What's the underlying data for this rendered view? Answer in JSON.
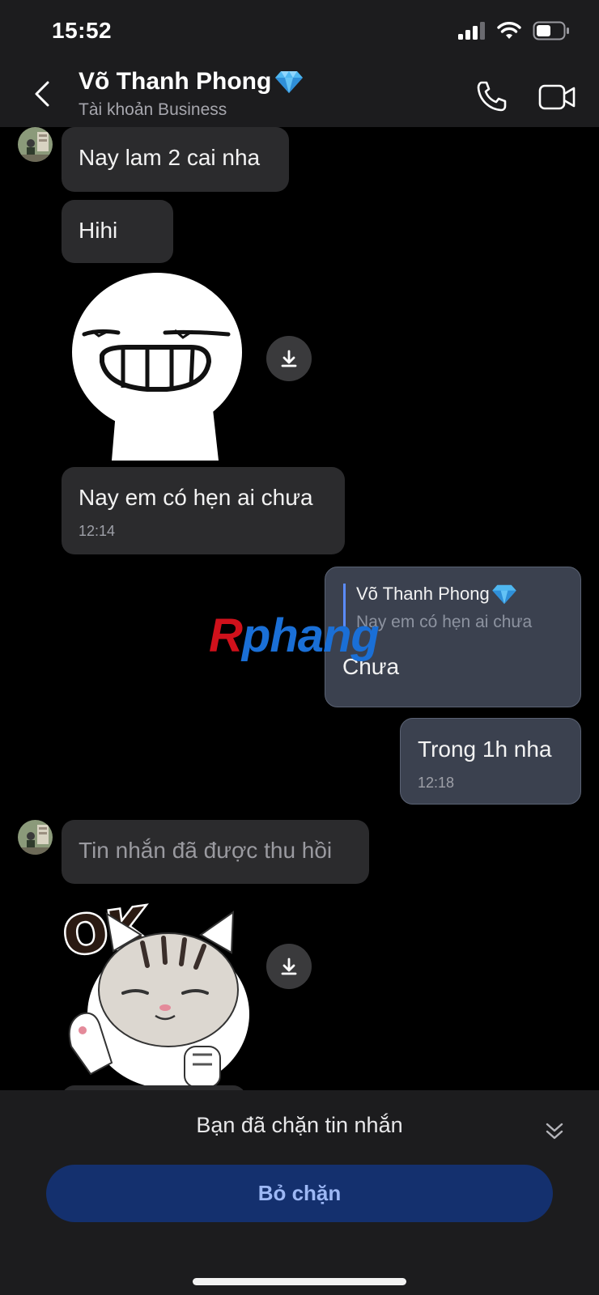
{
  "status_bar": {
    "time": "15:52"
  },
  "header": {
    "contact_name": "Võ Thanh Phong",
    "contact_subtitle": "Tài khoản Business",
    "badge_icon": "diamond-icon",
    "back_icon": "chevron-left-icon",
    "call_icon": "phone-icon",
    "video_icon": "video-camera-icon"
  },
  "messages": [
    {
      "text": "Nay lam 2 cai nha"
    },
    {
      "text": "Hihi"
    },
    {
      "sticker": "grinning-face-sticker"
    },
    {
      "text": "Nay em có hẹn ai chưa",
      "time": "12:14"
    },
    {
      "reply_to_name": "Võ Thanh Phong",
      "reply_to_text": "Nay em có hẹn ai chưa",
      "text": "Chưa"
    },
    {
      "text": "Trong 1h nha",
      "time": "12:18"
    },
    {
      "text": "Tin nhắn đã được thu hồi"
    },
    {
      "sticker": "ok-cat-sticker",
      "sticker_text": "OK"
    }
  ],
  "watermark": {
    "first": "R",
    "rest": "phang"
  },
  "footer": {
    "blocked_text": "Bạn đã chặn tin nhắn",
    "unblock_label": "Bỏ chặn",
    "collapse_icon": "double-chevron-down-icon"
  },
  "colors": {
    "background": "#000000",
    "bar": "#1c1c1e",
    "bubble_in": "#2b2b2d",
    "bubble_out": "#3b414f",
    "unblock_bg": "#14306e",
    "unblock_text": "#9db8f5"
  }
}
